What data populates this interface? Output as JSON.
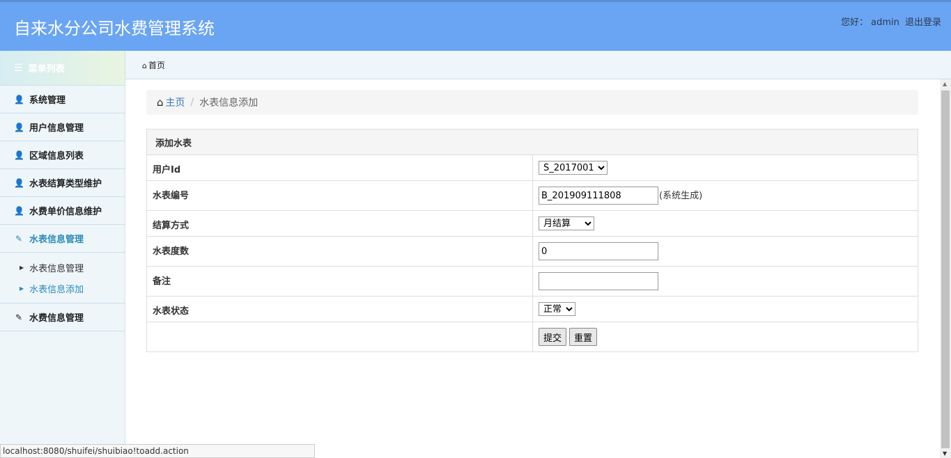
{
  "header": {
    "title": "自来水分公司水费管理系统",
    "greeting": "您好：",
    "username": "admin",
    "logout": "退出登录"
  },
  "sidebar": {
    "menu_title": "菜单列表",
    "items": [
      {
        "label": "系统管理",
        "icon": "user-icon"
      },
      {
        "label": "用户信息管理",
        "icon": "user-icon"
      },
      {
        "label": "区域信息列表",
        "icon": "user-icon"
      },
      {
        "label": "水表结算类型维护",
        "icon": "user-icon"
      },
      {
        "label": "水费单价信息维护",
        "icon": "user-icon"
      },
      {
        "label": "水表信息管理",
        "icon": "edit-icon",
        "active": true
      },
      {
        "label": "水费信息管理",
        "icon": "edit-icon"
      }
    ],
    "sub_items": [
      {
        "label": "水表信息管理"
      },
      {
        "label": "水表信息添加",
        "active": true
      }
    ]
  },
  "tabs": [
    {
      "label": "首页",
      "icon": "home-icon"
    }
  ],
  "breadcrumb": {
    "home": "主页",
    "current": "水表信息添加"
  },
  "form": {
    "title": "添加水表",
    "fields": {
      "user_id": {
        "label": "用户Id",
        "value": "S_2017001",
        "options": [
          "S_2017001"
        ]
      },
      "meter_no": {
        "label": "水表编号",
        "value": "B_201909111808",
        "hint": "(系统生成)"
      },
      "settle": {
        "label": "结算方式",
        "value": "月结算",
        "options": [
          "月结算"
        ]
      },
      "reading": {
        "label": "水表度数",
        "value": "0"
      },
      "remark": {
        "label": "备注",
        "value": ""
      },
      "status": {
        "label": "水表状态",
        "value": "正常",
        "options": [
          "正常"
        ]
      }
    },
    "submit": "提交",
    "reset": "重置"
  },
  "status_bar": {
    "url": "localhost:8080/shuifei/shuibiao!toadd.action"
  },
  "colors": {
    "header_bg": "#6aa5f3",
    "sidebar_bg": "#eef6fa",
    "active_link": "#2a8ab8",
    "breadcrumb_link": "#337ab7"
  }
}
